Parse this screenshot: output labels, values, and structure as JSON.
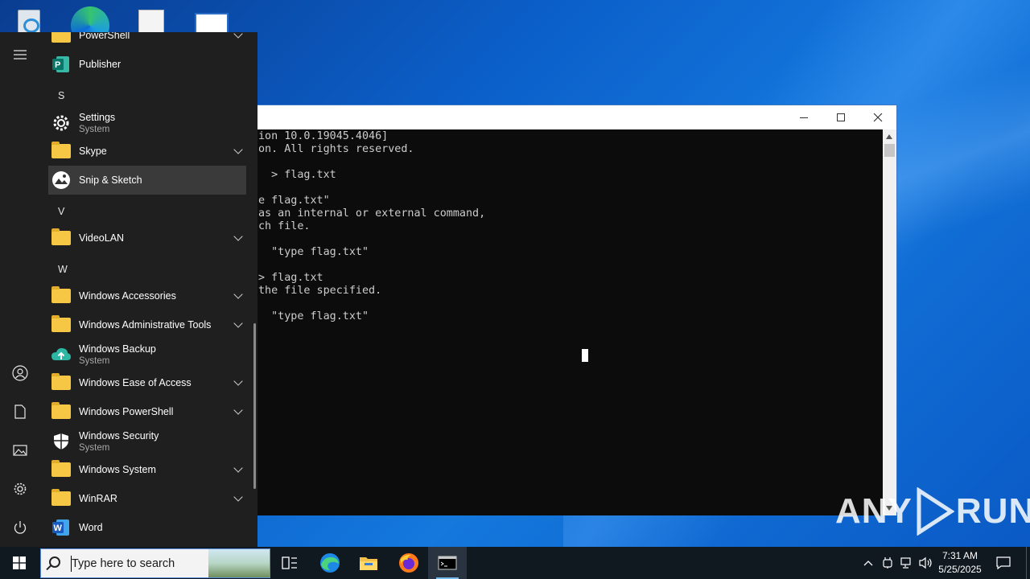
{
  "terminal": {
    "lines": [
      "ion 10.0.19045.4046]",
      "on. All rights reserved.",
      "",
      "  > flag.txt",
      "",
      "e flag.txt\"",
      "as an internal or external command,",
      "ch file.",
      "",
      "  \"type flag.txt\"",
      "",
      "> flag.txt",
      "the file specified.",
      "",
      "  \"type flag.txt\""
    ]
  },
  "start_menu": {
    "top_item": "PowerShell",
    "publisher": "Publisher",
    "letter_s": "S",
    "settings": {
      "name": "Settings",
      "sub": "System"
    },
    "skype": "Skype",
    "snip": "Snip & Sketch",
    "letter_v": "V",
    "videolan": "VideoLAN",
    "letter_w": "W",
    "win_accessories": "Windows Accessories",
    "win_admin": "Windows Administrative Tools",
    "win_backup": {
      "name": "Windows Backup",
      "sub": "System"
    },
    "win_ease": "Windows Ease of Access",
    "win_powershell": "Windows PowerShell",
    "win_security": {
      "name": "Windows Security",
      "sub": "System"
    },
    "win_system": "Windows System",
    "winrar": "WinRAR",
    "word": "Word"
  },
  "taskbar": {
    "search_placeholder": "Type here to search",
    "time": "7:31 AM",
    "date": "5/25/2025"
  },
  "watermark": {
    "left": "ANY",
    "right": "RUN"
  },
  "colors": {
    "desktop": "#0b5fc9",
    "start_menu_bg": "#1f1f1f",
    "taskbar_bg": "#101820",
    "folder": "#f6c645",
    "terminal_bg": "#0c0c0c"
  }
}
